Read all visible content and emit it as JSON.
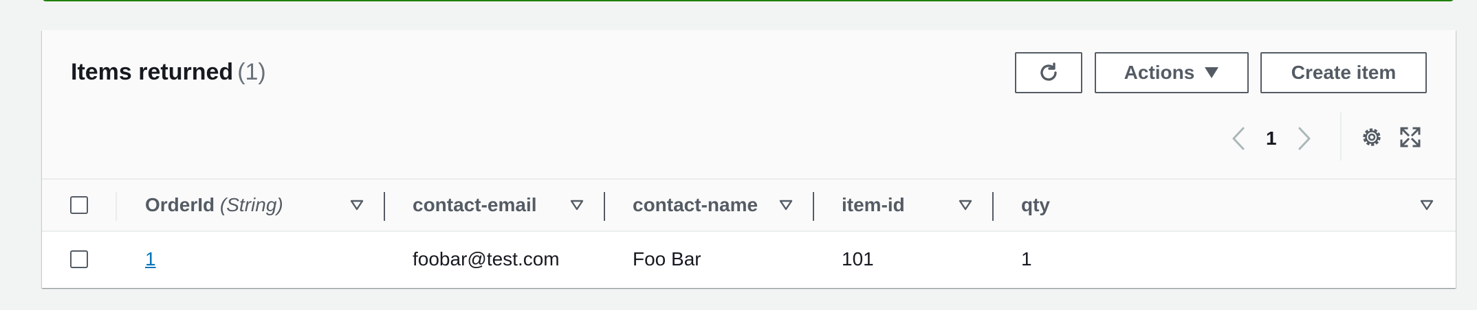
{
  "panel": {
    "title": "Items returned",
    "count": "(1)"
  },
  "toolbar": {
    "refresh_icon": "refresh-icon",
    "actions_label": "Actions",
    "create_label": "Create item"
  },
  "pagination": {
    "current_page": "1",
    "prev_icon": "chevron-left-icon",
    "next_icon": "chevron-right-icon",
    "settings_icon": "gear-icon",
    "fullscreen_icon": "expand-icon"
  },
  "table": {
    "columns": [
      {
        "name": "OrderId",
        "type": "(String)"
      },
      {
        "name": "contact-email"
      },
      {
        "name": "contact-name"
      },
      {
        "name": "item-id"
      },
      {
        "name": "qty"
      }
    ],
    "rows": [
      {
        "OrderId": "1",
        "contact-email": "foobar@test.com",
        "contact-name": "Foo Bar",
        "item-id": "101",
        "qty": "1"
      }
    ]
  },
  "colors": {
    "link": "#0073bb",
    "success_border": "#1d8102",
    "text": "#16191f",
    "muted": "#545b64"
  }
}
